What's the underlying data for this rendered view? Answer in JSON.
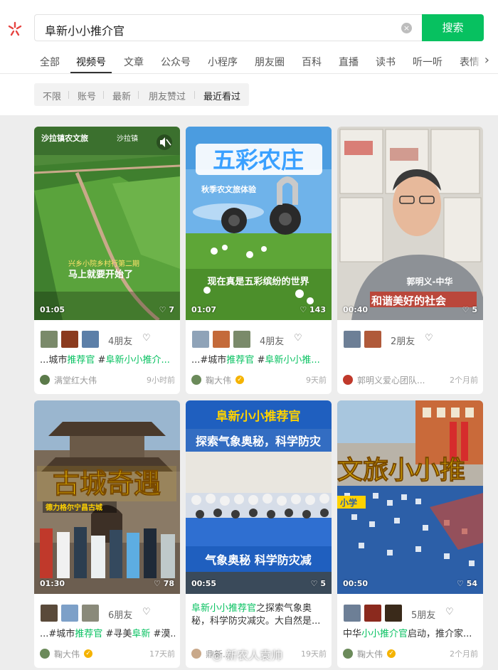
{
  "search": {
    "query": "阜新小小推介官",
    "clear_icon": "×",
    "button_label": "搜索"
  },
  "tabs": [
    "全部",
    "视频号",
    "文章",
    "公众号",
    "小程序",
    "朋友圈",
    "百科",
    "直播",
    "读书",
    "听一听",
    "表情"
  ],
  "active_tab": "视频号",
  "filters": [
    "不限",
    "账号",
    "最新",
    "朋友赞过",
    "最近看过"
  ],
  "active_filter": "最近看过",
  "cards": [
    {
      "overlay_top": "沙拉镇农文旅",
      "overlay_loc": "沙拉镇",
      "overlay_sub": "兴乡小院乡村行第二期",
      "overlay_main": "马上就要开始了",
      "duration": "01:05",
      "likes": "7",
      "friends": "4朋友",
      "desc_pre": "...城市",
      "desc_hl1": "推荐官",
      "desc_mid": " #",
      "desc_hl2": "阜新小小推介...",
      "desc_post": "",
      "author": "满堂红大伟",
      "time": "9小时前"
    },
    {
      "overlay_title": "五彩农庄",
      "overlay_sub": "秋季农文旅体验",
      "overlay_main": "现在真是五彩缤纷的世界",
      "duration": "01:07",
      "likes": "143",
      "friends": "4朋友",
      "desc_pre": "...#城市",
      "desc_hl1": "推荐官",
      "desc_mid": " #",
      "desc_hl2": "阜新小小推...",
      "desc_post": "",
      "author": "鞠大伟",
      "time": "9天前"
    },
    {
      "overlay_name": "郭明义-中华",
      "overlay_main": "和谐美好的社会",
      "duration": "00:40",
      "likes": "5",
      "friends": "2朋友",
      "desc_pre": "",
      "desc_hl1": "",
      "desc_mid": "",
      "desc_hl2": "",
      "desc_post": "",
      "author": "郭明义爱心团队...",
      "time": "2个月前"
    },
    {
      "overlay_title": "古城奇遇",
      "overlay_sub": "德力格尔宁昌古城",
      "duration": "01:30",
      "likes": "78",
      "friends": "6朋友",
      "desc_pre": "...#城市",
      "desc_hl1": "推荐官",
      "desc_mid": " #寻美",
      "desc_hl2": "阜新",
      "desc_post": " #漠...",
      "author": "鞠大伟",
      "time": "17天前"
    },
    {
      "overlay_title": "阜新小小推荐官",
      "overlay_line2": "探索气象奥秘，科学防灾",
      "overlay_banner": "气象奥秘 科学防灾减",
      "duration": "00:55",
      "likes": "5",
      "friends": "",
      "desc_hl1": "阜新小小推荐官",
      "desc_post": "之探索气象奥秘，科学防灾减灾。大自然是...",
      "author": "鼎新...",
      "time": "19天前"
    },
    {
      "overlay_title": "文旅小小推",
      "overlay_sub": "小学",
      "duration": "00:50",
      "likes": "54",
      "friends": "5朋友",
      "desc_pre": "中华",
      "desc_hl1": "小小推介官",
      "desc_mid": "启动，推介家...",
      "desc_hl2": "",
      "desc_post": "",
      "author": "鞠大伟",
      "time": "2个月前"
    }
  ],
  "watermark": "新农人袁帅",
  "colors": {
    "accent": "#07c160",
    "page_bg": "#ededed",
    "verified": "#f5b300"
  }
}
